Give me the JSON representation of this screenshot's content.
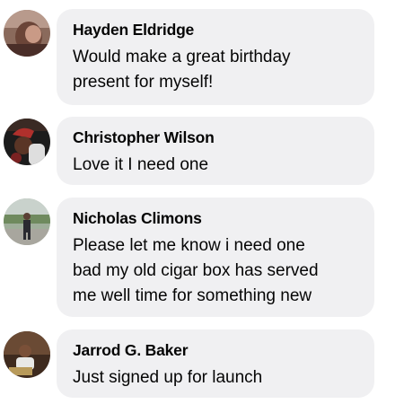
{
  "comments": [
    {
      "author": "Hayden Eldridge",
      "text": "Would make a great birthday\npresent for myself!",
      "avatar_icon": "user-photo-avatar"
    },
    {
      "author": "Christopher Wilson",
      "text": "Love it I need one",
      "avatar_icon": "user-photo-avatar"
    },
    {
      "author": "Nicholas Climons",
      "text": "Please let me know i need one\nbad my old cigar box has served\nme well time for something new",
      "avatar_icon": "user-photo-avatar"
    },
    {
      "author": "Jarrod G. Baker",
      "text": "Just signed up for launch",
      "avatar_icon": "user-photo-avatar"
    }
  ],
  "colors": {
    "bubble": "#f0f0f2",
    "text": "#050505",
    "background": "#ffffff"
  }
}
